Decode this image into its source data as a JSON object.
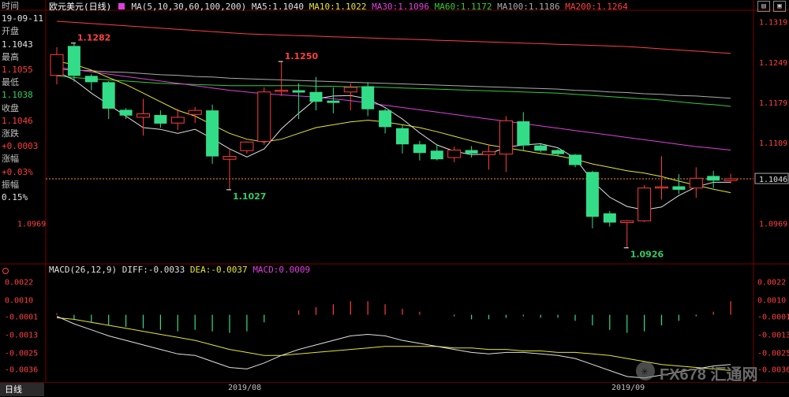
{
  "header": {
    "symbol": "欧元美元(日线)",
    "ma_legend": "MA(5,10,30,60,100,200)",
    "ma5": "MA5:1.1040",
    "ma10": "MA10:1.1022",
    "ma30": "MA30:1.1096",
    "ma60": "MA60:1.1172",
    "ma100": "MA100:1.1186",
    "ma200": "MA200:1.1264"
  },
  "info_panel": {
    "time_label": "时间",
    "time_value": "19-09-11",
    "open_label": "开盘",
    "open_value": "1.1043",
    "high_label": "最高",
    "high_value": "1.1055",
    "low_label": "最低",
    "low_value": "1.1038",
    "close_label": "收盘",
    "close_value": "1.1046",
    "change_label": "涨跌",
    "change_value": "+0.0003",
    "pct_label": "涨幅",
    "pct_value": "+0.03%",
    "amp_label": "振幅",
    "amp_value": "0.15%"
  },
  "macd_header": {
    "params": "MACD(26,12,9)",
    "diff": "DIFF:-0.0033",
    "dea": "DEA:-0.0037",
    "macd": "MACD:0.0009"
  },
  "bottom": {
    "period_tab": "日线",
    "date_labels": [
      "2019/08",
      "2019/09"
    ]
  },
  "watermark": "FX678 汇通网",
  "colors": {
    "up": "#ff3c3c",
    "down": "#33dd88",
    "ma5": "#e0e0e0",
    "ma10": "#e6e632",
    "ma30": "#e040e0",
    "ma60": "#33cc33",
    "ma100": "#aaaaaa",
    "ma200": "#ff4040",
    "diff": "#e0e0e0",
    "dea": "#e6e632"
  },
  "chart_data": [
    {
      "type": "candlestick",
      "title": "欧元美元(日线)",
      "yticks": [
        "1.1319",
        "1.1249",
        "1.1179",
        "1.1109",
        "1.1046",
        "1.0969"
      ],
      "ylim": [
        1.0905,
        1.1335
      ],
      "annotations": [
        {
          "label": "1.1282",
          "value": 1.1282
        },
        {
          "label": "1.1250",
          "value": 1.125
        },
        {
          "label": "1.1027",
          "value": 1.1027
        },
        {
          "label": "1.0926",
          "value": 1.0926
        }
      ],
      "current_price": 1.1046,
      "candles": [
        {
          "o": 1.1226,
          "h": 1.1275,
          "l": 1.121,
          "c": 1.1262
        },
        {
          "o": 1.1277,
          "h": 1.1282,
          "l": 1.1215,
          "c": 1.1225
        },
        {
          "o": 1.1225,
          "h": 1.1228,
          "l": 1.12,
          "c": 1.1214
        },
        {
          "o": 1.1214,
          "h": 1.1216,
          "l": 1.115,
          "c": 1.1168
        },
        {
          "o": 1.1166,
          "h": 1.1169,
          "l": 1.115,
          "c": 1.1156
        },
        {
          "o": 1.1153,
          "h": 1.1185,
          "l": 1.1121,
          "c": 1.1159
        },
        {
          "o": 1.1157,
          "h": 1.1165,
          "l": 1.1135,
          "c": 1.1142
        },
        {
          "o": 1.1143,
          "h": 1.1168,
          "l": 1.1131,
          "c": 1.1153
        },
        {
          "o": 1.1158,
          "h": 1.1171,
          "l": 1.1143,
          "c": 1.1165
        },
        {
          "o": 1.1165,
          "h": 1.1175,
          "l": 1.1072,
          "c": 1.1085
        },
        {
          "o": 1.108,
          "h": 1.1098,
          "l": 1.1027,
          "c": 1.1085
        },
        {
          "o": 1.1095,
          "h": 1.1111,
          "l": 1.109,
          "c": 1.111
        },
        {
          "o": 1.1111,
          "h": 1.1205,
          "l": 1.1105,
          "c": 1.1197
        },
        {
          "o": 1.1198,
          "h": 1.125,
          "l": 1.119,
          "c": 1.12
        },
        {
          "o": 1.12,
          "h": 1.1212,
          "l": 1.115,
          "c": 1.1196
        },
        {
          "o": 1.1197,
          "h": 1.1223,
          "l": 1.1165,
          "c": 1.118
        },
        {
          "o": 1.1182,
          "h": 1.1205,
          "l": 1.116,
          "c": 1.1178
        },
        {
          "o": 1.1197,
          "h": 1.1212,
          "l": 1.1165,
          "c": 1.1205
        },
        {
          "o": 1.1207,
          "h": 1.1214,
          "l": 1.1155,
          "c": 1.1167
        },
        {
          "o": 1.1165,
          "h": 1.1168,
          "l": 1.1125,
          "c": 1.1136
        },
        {
          "o": 1.1134,
          "h": 1.1139,
          "l": 1.109,
          "c": 1.1106
        },
        {
          "o": 1.1106,
          "h": 1.1112,
          "l": 1.1078,
          "c": 1.1091
        },
        {
          "o": 1.1095,
          "h": 1.1106,
          "l": 1.1078,
          "c": 1.108
        },
        {
          "o": 1.1083,
          "h": 1.1102,
          "l": 1.1075,
          "c": 1.1096
        },
        {
          "o": 1.1096,
          "h": 1.1103,
          "l": 1.1083,
          "c": 1.109
        },
        {
          "o": 1.1088,
          "h": 1.1105,
          "l": 1.1062,
          "c": 1.1093
        },
        {
          "o": 1.1089,
          "h": 1.1155,
          "l": 1.1058,
          "c": 1.1147
        },
        {
          "o": 1.1146,
          "h": 1.1162,
          "l": 1.1095,
          "c": 1.1104
        },
        {
          "o": 1.1104,
          "h": 1.1106,
          "l": 1.1092,
          "c": 1.1095
        },
        {
          "o": 1.1096,
          "h": 1.1098,
          "l": 1.1085,
          "c": 1.1089
        },
        {
          "o": 1.1088,
          "h": 1.1089,
          "l": 1.1066,
          "c": 1.107
        },
        {
          "o": 1.1058,
          "h": 1.106,
          "l": 1.096,
          "c": 1.098
        },
        {
          "o": 1.0986,
          "h": 1.099,
          "l": 1.0963,
          "c": 1.097
        },
        {
          "o": 1.097,
          "h": 1.0974,
          "l": 1.0926,
          "c": 1.0973
        },
        {
          "o": 1.0973,
          "h": 1.1035,
          "l": 1.0971,
          "c": 1.103
        },
        {
          "o": 1.103,
          "h": 1.1085,
          "l": 1.101,
          "c": 1.1032
        },
        {
          "o": 1.1033,
          "h": 1.1054,
          "l": 1.102,
          "c": 1.1027
        },
        {
          "o": 1.103,
          "h": 1.1066,
          "l": 1.1013,
          "c": 1.1047
        },
        {
          "o": 1.1051,
          "h": 1.106,
          "l": 1.103,
          "c": 1.1043
        },
        {
          "o": 1.1043,
          "h": 1.1055,
          "l": 1.1038,
          "c": 1.1046
        }
      ],
      "ma5": [
        1.1232,
        1.1218,
        1.1195,
        1.1175,
        1.1155,
        1.1135,
        1.1132,
        1.1125,
        1.1132,
        1.1116,
        1.1098,
        1.1084,
        1.1098,
        1.1133,
        1.116,
        1.1185,
        1.119,
        1.1191,
        1.1185,
        1.117,
        1.115,
        1.1126,
        1.1105,
        1.1094,
        1.1088,
        1.1089,
        1.1101,
        1.1105,
        1.1107,
        1.11,
        1.1082,
        1.1042,
        1.1014,
        1.0998,
        1.0992,
        1.0997,
        1.1017,
        1.1032,
        1.104,
        1.104
      ],
      "ma10": [
        1.125,
        1.1245,
        1.1235,
        1.1222,
        1.121,
        1.1195,
        1.118,
        1.1165,
        1.1155,
        1.114,
        1.1125,
        1.1115,
        1.111,
        1.1115,
        1.1125,
        1.1135,
        1.114,
        1.1145,
        1.1148,
        1.1145,
        1.114,
        1.1135,
        1.1128,
        1.112,
        1.1112,
        1.1105,
        1.11,
        1.1095,
        1.109,
        1.1086,
        1.108,
        1.1072,
        1.1066,
        1.106,
        1.1056,
        1.105,
        1.1042,
        1.1035,
        1.1028,
        1.1022
      ],
      "ma30": [
        1.124,
        1.1236,
        1.1232,
        1.1228,
        1.1224,
        1.122,
        1.1216,
        1.1212,
        1.1208,
        1.1204,
        1.12,
        1.1197,
        1.1194,
        1.1192,
        1.119,
        1.1188,
        1.1185,
        1.1182,
        1.1178,
        1.1174,
        1.117,
        1.1166,
        1.1162,
        1.1158,
        1.1154,
        1.115,
        1.1146,
        1.1142,
        1.1138,
        1.1134,
        1.113,
        1.1126,
        1.1122,
        1.1118,
        1.1114,
        1.111,
        1.1106,
        1.1102,
        1.1099,
        1.1096
      ],
      "ma60": [
        1.1225,
        1.1222,
        1.122,
        1.1218,
        1.1216,
        1.1214,
        1.1212,
        1.1211,
        1.121,
        1.1209,
        1.1208,
        1.1208,
        1.1208,
        1.1208,
        1.1208,
        1.1207,
        1.1207,
        1.1206,
        1.1206,
        1.1205,
        1.1204,
        1.1203,
        1.1202,
        1.1201,
        1.12,
        1.1199,
        1.1198,
        1.1197,
        1.1196,
        1.1195,
        1.1193,
        1.1191,
        1.1189,
        1.1187,
        1.1185,
        1.1183,
        1.118,
        1.1177,
        1.1175,
        1.1172
      ],
      "ma100": [
        1.1237,
        1.1235,
        1.1234,
        1.1232,
        1.1231,
        1.1229,
        1.1227,
        1.1226,
        1.1224,
        1.1223,
        1.1221,
        1.122,
        1.1219,
        1.1218,
        1.1217,
        1.1216,
        1.1215,
        1.1214,
        1.1213,
        1.1212,
        1.1211,
        1.121,
        1.1209,
        1.1208,
        1.1207,
        1.1206,
        1.1205,
        1.1204,
        1.1203,
        1.1202,
        1.12,
        1.1199,
        1.1197,
        1.1196,
        1.1194,
        1.1193,
        1.1191,
        1.119,
        1.1188,
        1.1186
      ],
      "ma200": [
        1.132,
        1.1318,
        1.1316,
        1.1314,
        1.1312,
        1.131,
        1.1308,
        1.1306,
        1.1304,
        1.1302,
        1.13,
        1.1298,
        1.1297,
        1.1296,
        1.1295,
        1.1294,
        1.1293,
        1.1292,
        1.1291,
        1.129,
        1.1289,
        1.1288,
        1.1287,
        1.1286,
        1.1285,
        1.1284,
        1.1283,
        1.1282,
        1.1281,
        1.128,
        1.1279,
        1.1278,
        1.1277,
        1.1276,
        1.1274,
        1.1272,
        1.127,
        1.1268,
        1.1266,
        1.1264
      ]
    },
    {
      "type": "macd",
      "title": "MACD(26,12,9)",
      "yticks": [
        "0.0022",
        "0.0010",
        "-0.0001",
        "-0.0013",
        "-0.0025",
        "-0.0036"
      ],
      "ylim": [
        -0.0041,
        0.0027
      ],
      "diff": [
        -0.0001,
        -0.0006,
        -0.001,
        -0.0014,
        -0.0017,
        -0.002,
        -0.0023,
        -0.0026,
        -0.0027,
        -0.0031,
        -0.0035,
        -0.0036,
        -0.0032,
        -0.0027,
        -0.0023,
        -0.002,
        -0.0017,
        -0.0014,
        -0.0013,
        -0.0014,
        -0.0017,
        -0.0019,
        -0.0021,
        -0.0023,
        -0.0025,
        -0.0026,
        -0.0025,
        -0.0025,
        -0.0026,
        -0.0027,
        -0.0029,
        -0.0033,
        -0.0037,
        -0.0041,
        -0.0042,
        -0.004,
        -0.0038,
        -0.0036,
        -0.0034,
        -0.0033
      ],
      "dea": [
        -0.0002,
        -0.0003,
        -0.0005,
        -0.0007,
        -0.0009,
        -0.0011,
        -0.0013,
        -0.0015,
        -0.0017,
        -0.002,
        -0.0023,
        -0.0025,
        -0.0027,
        -0.0027,
        -0.0026,
        -0.0025,
        -0.0024,
        -0.0023,
        -0.0022,
        -0.0021,
        -0.0021,
        -0.0021,
        -0.0021,
        -0.0022,
        -0.0022,
        -0.0023,
        -0.0023,
        -0.0024,
        -0.0024,
        -0.0025,
        -0.0025,
        -0.0026,
        -0.0027,
        -0.0029,
        -0.0031,
        -0.0033,
        -0.0034,
        -0.0035,
        -0.0036,
        -0.0037
      ],
      "macd": [
        0.0001,
        -0.0003,
        -0.0005,
        -0.0007,
        -0.0008,
        -0.0009,
        -0.001,
        -0.0011,
        -0.001,
        -0.0011,
        -0.0012,
        -0.0011,
        -0.0005,
        0.0,
        0.0003,
        0.0005,
        0.0007,
        0.0009,
        0.0009,
        0.0007,
        0.0004,
        0.0002,
        0.0,
        -0.0001,
        -0.0003,
        -0.0003,
        -0.0002,
        -0.0001,
        -0.0002,
        -0.0002,
        -0.0004,
        -0.0007,
        -0.001,
        -0.0012,
        -0.0011,
        -0.0007,
        -0.0004,
        -0.0001,
        0.0002,
        0.0009
      ]
    }
  ]
}
